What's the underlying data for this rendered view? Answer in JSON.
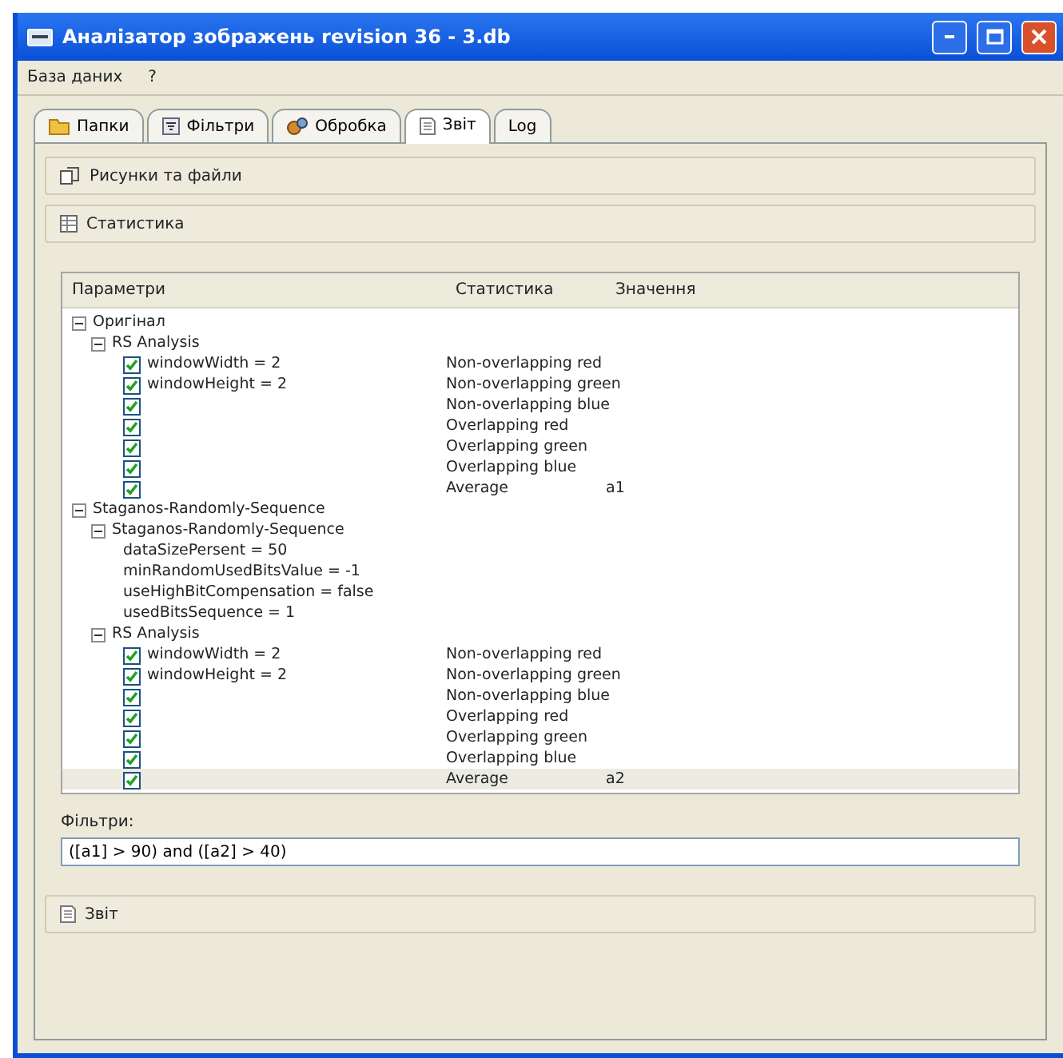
{
  "window": {
    "title": "Аналізатор зображень revision 36 - 3.db"
  },
  "menu": [
    {
      "label": "База даних"
    },
    {
      "label": "?"
    }
  ],
  "tabs": [
    {
      "label": "Папки",
      "selected": false
    },
    {
      "label": "Фільтри",
      "selected": false
    },
    {
      "label": "Обробка",
      "selected": false
    },
    {
      "label": "Звіт",
      "selected": true
    },
    {
      "label": "Log",
      "selected": false
    }
  ],
  "sections": [
    {
      "label": "Рисунки та файли"
    },
    {
      "label": "Статистика"
    }
  ],
  "table": {
    "columns": [
      "Параметри",
      "Статистика",
      "Значення"
    ],
    "tree": [
      {
        "kind": "group",
        "label": "Оригінал",
        "expanded": true,
        "children": [
          {
            "kind": "group",
            "label": "RS Analysis",
            "expanded": true,
            "children": [
              {
                "kind": "check",
                "checked": true,
                "selected": false,
                "param": "windowWidth = 2",
                "statistic": "Non-overlapping red"
              },
              {
                "kind": "check",
                "checked": true,
                "selected": false,
                "param": "windowHeight = 2",
                "statistic": "Non-overlapping green"
              },
              {
                "kind": "check",
                "checked": true,
                "selected": false,
                "statistic": "Non-overlapping blue"
              },
              {
                "kind": "check",
                "checked": true,
                "selected": false,
                "statistic": "Overlapping red"
              },
              {
                "kind": "check",
                "checked": true,
                "selected": false,
                "statistic": "Overlapping green"
              },
              {
                "kind": "check",
                "checked": true,
                "selected": false,
                "statistic": "Overlapping blue"
              },
              {
                "kind": "check",
                "checked": true,
                "selected": false,
                "statistic": "Average",
                "value": "a1"
              }
            ]
          }
        ]
      },
      {
        "kind": "group",
        "label": "Staganos-Randomly-Sequence",
        "expanded": true,
        "children": [
          {
            "kind": "group",
            "label": "Staganos-Randomly-Sequence",
            "expanded": true,
            "children": [
              {
                "kind": "param",
                "label": "dataSizePersent = 50"
              },
              {
                "kind": "param",
                "label": "minRandomUsedBitsValue = -1"
              },
              {
                "kind": "param",
                "label": "useHighBitCompensation = false"
              },
              {
                "kind": "param",
                "label": "usedBitsSequence = 1"
              }
            ]
          },
          {
            "kind": "group",
            "label": "RS Analysis",
            "expanded": true,
            "children": [
              {
                "kind": "check",
                "checked": true,
                "selected": false,
                "param": "windowWidth = 2",
                "statistic": "Non-overlapping red"
              },
              {
                "kind": "check",
                "checked": true,
                "selected": false,
                "param": "windowHeight = 2",
                "statistic": "Non-overlapping green"
              },
              {
                "kind": "check",
                "checked": true,
                "selected": false,
                "statistic": "Non-overlapping blue"
              },
              {
                "kind": "check",
                "checked": true,
                "selected": false,
                "statistic": "Overlapping red"
              },
              {
                "kind": "check",
                "checked": true,
                "selected": false,
                "statistic": "Overlapping green"
              },
              {
                "kind": "check",
                "checked": true,
                "selected": false,
                "statistic": "Overlapping blue"
              },
              {
                "kind": "check",
                "checked": true,
                "selected": true,
                "statistic": "Average",
                "value": "a2"
              }
            ]
          }
        ]
      }
    ]
  },
  "filter": {
    "label": "Фільтри:",
    "value": "([a1] > 90) and ([a2] > 40)"
  },
  "report_section": {
    "label": "Звіт"
  }
}
